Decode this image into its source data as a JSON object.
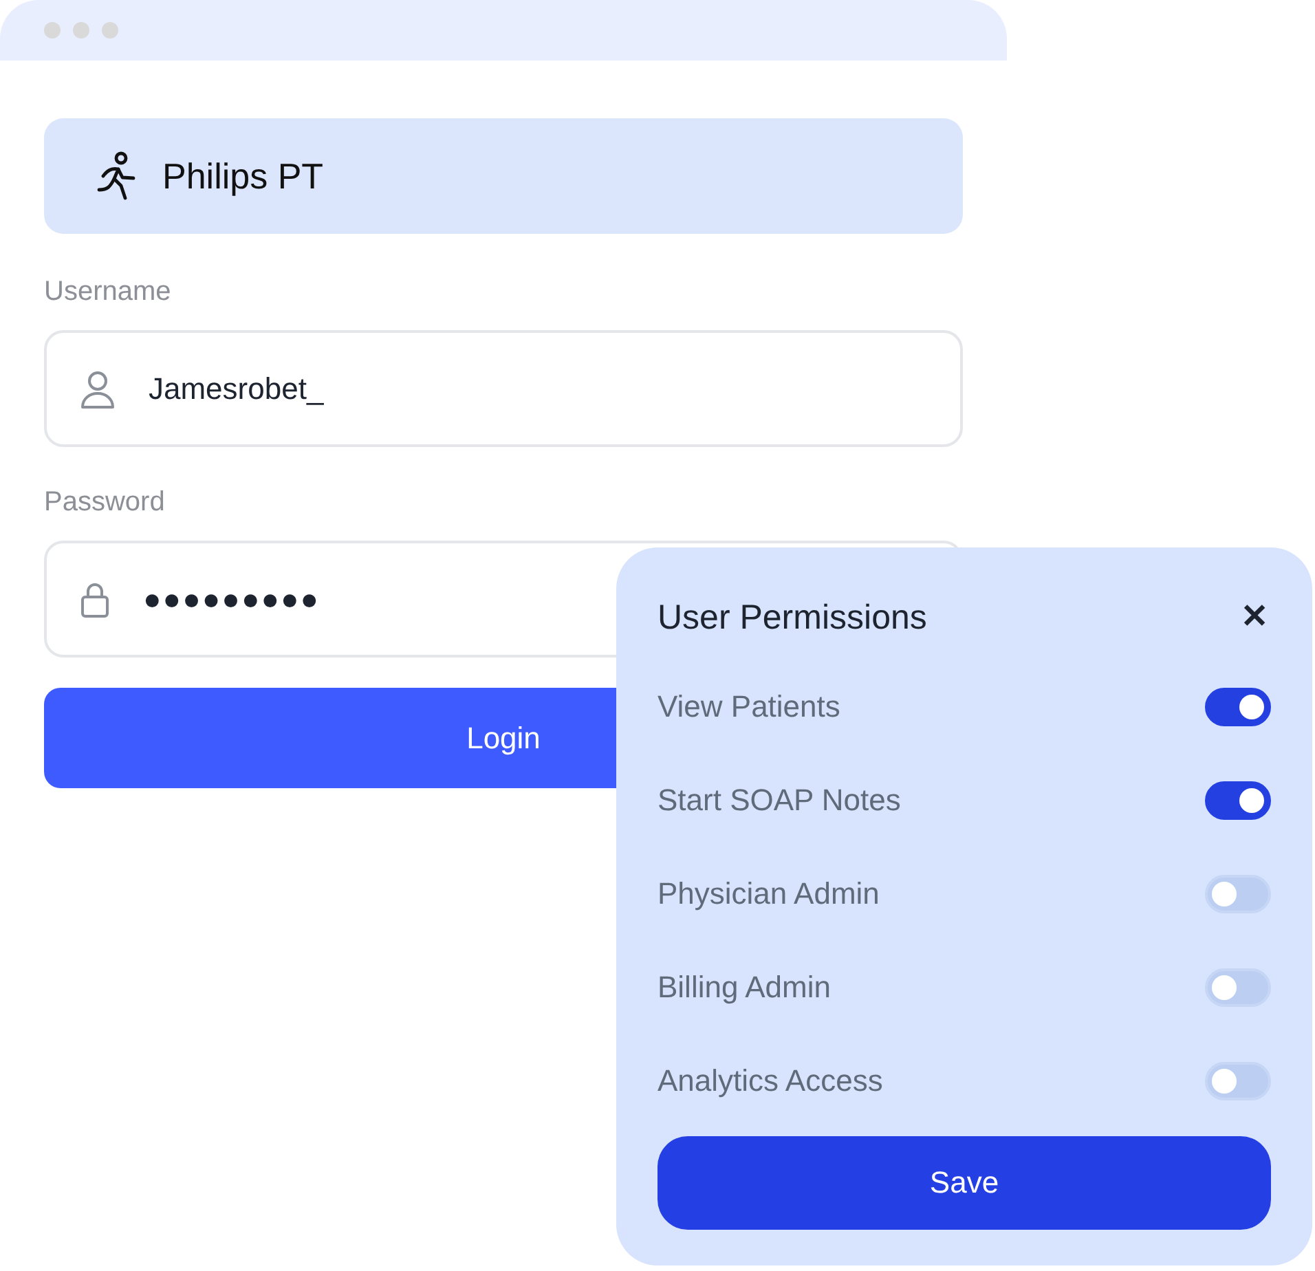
{
  "brand": {
    "name": "Philips PT"
  },
  "username": {
    "label": "Username",
    "value": "Jamesrobet_"
  },
  "password": {
    "label": "Password",
    "value": "●●●●●●●●●"
  },
  "login_button": "Login",
  "permissions": {
    "title": "User Permissions",
    "close": "✕",
    "items": [
      {
        "label": "View Patients",
        "on": true
      },
      {
        "label": "Start SOAP Notes",
        "on": true
      },
      {
        "label": "Physician Admin",
        "on": false
      },
      {
        "label": "Billing Admin",
        "on": false
      },
      {
        "label": "Analytics Access",
        "on": false
      }
    ],
    "save_button": "Save"
  }
}
